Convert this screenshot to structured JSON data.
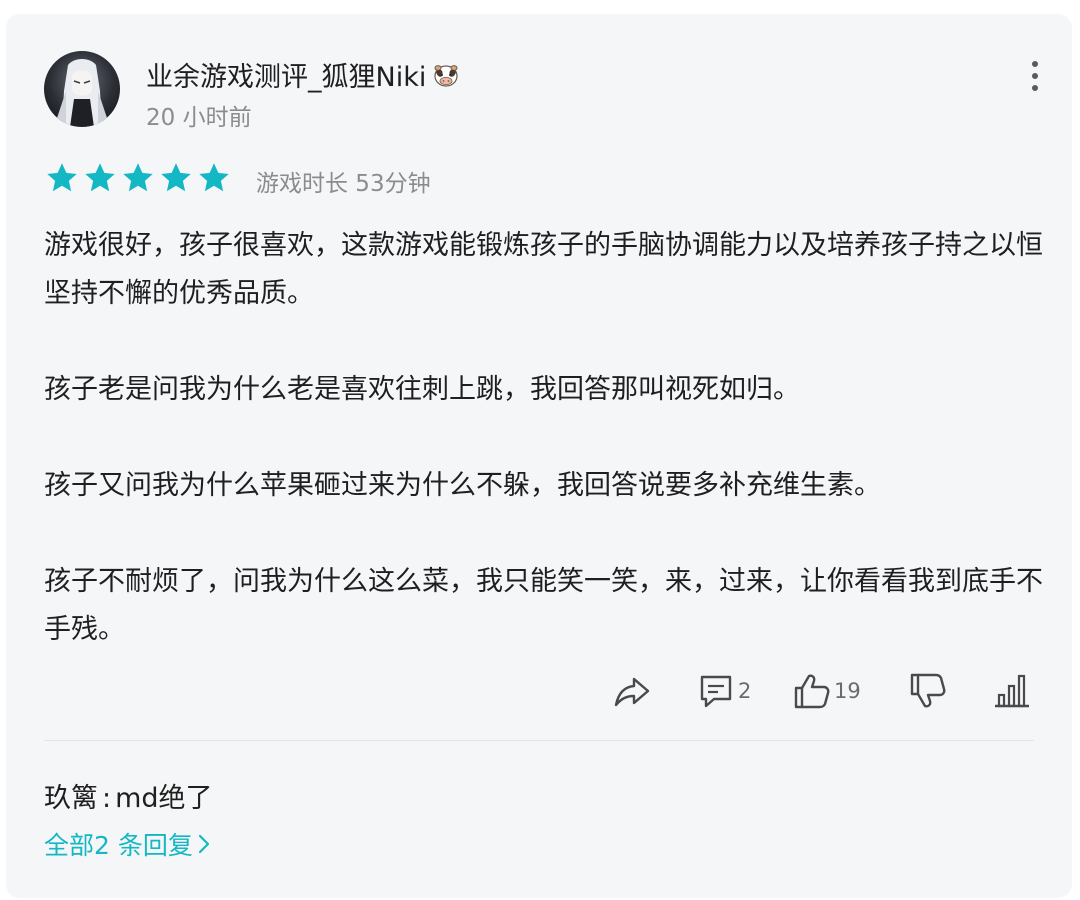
{
  "review": {
    "author": {
      "name": "业余游戏测评_狐狸Niki",
      "avatar_icon": "user-avatar",
      "badge_icon": "cow-badge-icon"
    },
    "timestamp": "20 小时前",
    "rating": {
      "value": 5,
      "max": 5,
      "color": "#14b8c5"
    },
    "playtime": "游戏时长 53分钟",
    "paragraphs": [
      "游戏很好，孩子很喜欢，这款游戏能锻炼孩子的手脑协调能力以及培养孩子持之以恒坚持不懈的优秀品质。",
      "孩子老是问我为什么老是喜欢往刺上跳，我回答那叫视死如归。",
      "孩子又问我为什么苹果砸过来为什么不躲，我回答说要多补充维生素。",
      "孩子不耐烦了，问我为什么这么菜，我只能笑一笑，来，过来，让你看看我到底手不手残。"
    ],
    "actions": {
      "share_icon": "share-icon",
      "comment_icon": "comment-icon",
      "comment_count": "2",
      "like_icon": "thumbs-up-icon",
      "like_count": "19",
      "dislike_icon": "thumbs-down-icon",
      "stats_icon": "bar-chart-icon"
    },
    "reply_preview": {
      "author": "玖篱",
      "separator": ":",
      "text": "md绝了"
    },
    "all_replies_link": "全部2 条回复",
    "accent_color": "#14b8c5"
  }
}
